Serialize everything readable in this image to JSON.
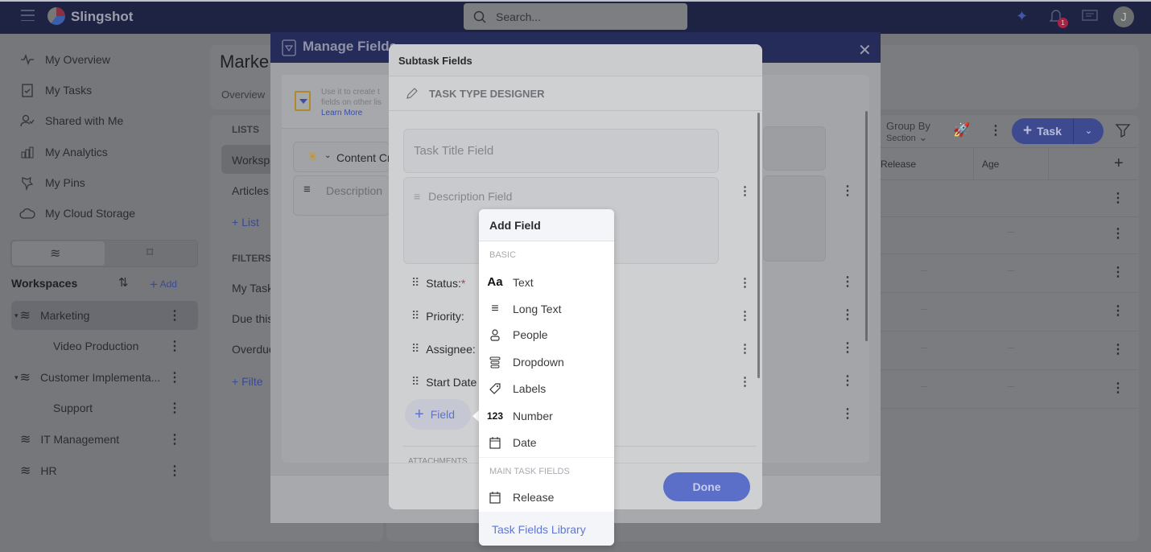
{
  "topbar": {
    "brand": "Slingshot",
    "search_placeholder": "Search...",
    "notification_count": "1",
    "avatar_initial": "J"
  },
  "sidebar": {
    "nav": [
      {
        "label": "My Overview",
        "icon": "activity-icon"
      },
      {
        "label": "My Tasks",
        "icon": "clipboard-check-icon"
      },
      {
        "label": "Shared with Me",
        "icon": "user-check-icon"
      },
      {
        "label": "My Analytics",
        "icon": "bar-chart-icon"
      },
      {
        "label": "My Pins",
        "icon": "pin-icon"
      },
      {
        "label": "My Cloud Storage",
        "icon": "cloud-icon"
      }
    ],
    "workspaces_title": "Workspaces",
    "add_label": "Add",
    "workspaces": [
      {
        "label": "Marketing",
        "level": 0,
        "selected": true
      },
      {
        "label": "Video Production",
        "level": 1
      },
      {
        "label": "Customer Implementa...",
        "level": 0
      },
      {
        "label": "Support",
        "level": 1
      },
      {
        "label": "IT Management",
        "level": 0
      },
      {
        "label": "HR",
        "level": 0
      }
    ]
  },
  "page": {
    "title": "Marke",
    "tab_overview": "Overview"
  },
  "lists": {
    "heading": "LISTS",
    "items": [
      "Workspa",
      "Articles"
    ],
    "add_list": "List",
    "filters_heading": "FILTERS",
    "filters": [
      "My Task",
      "Due this",
      "Overdue"
    ],
    "add_filter": "Filte"
  },
  "manage_fields": {
    "title": "Manage Fields",
    "info_text_1": "Use it to create t",
    "info_text_2": "fields on other lis",
    "learn_more": "Learn More",
    "task_type": "Content Cre",
    "description": "Description"
  },
  "subtask": {
    "title": "Subtask Fields",
    "designer": "TASK TYPE DESIGNER",
    "title_field": "Task Title Field",
    "description_field": "Description Field",
    "rows": [
      {
        "label": "Status:",
        "required": true
      },
      {
        "label": "Priority:"
      },
      {
        "label": "Assignee:"
      },
      {
        "label": "Start Date -"
      }
    ],
    "add_field": "Field",
    "attachments": "ATTACHMENTS",
    "done": "Done"
  },
  "popup": {
    "title": "Add Field",
    "section_basic": "BASIC",
    "basic": [
      {
        "label": "Text",
        "icon": "text-icon"
      },
      {
        "label": "Long Text",
        "icon": "long-text-icon"
      },
      {
        "label": "People",
        "icon": "person-icon"
      },
      {
        "label": "Dropdown",
        "icon": "dropdown-icon"
      },
      {
        "label": "Labels",
        "icon": "tag-icon"
      },
      {
        "label": "Number",
        "icon": "number-icon"
      },
      {
        "label": "Date",
        "icon": "calendar-icon"
      }
    ],
    "section_main": "MAIN TASK FIELDS",
    "main": [
      {
        "label": "Release",
        "icon": "calendar-icon"
      }
    ],
    "footer": "Task Fields Library"
  },
  "table": {
    "group_by": "Group By",
    "group_value": "Section",
    "add_task": "Task",
    "columns": [
      "Release",
      "Age"
    ]
  }
}
